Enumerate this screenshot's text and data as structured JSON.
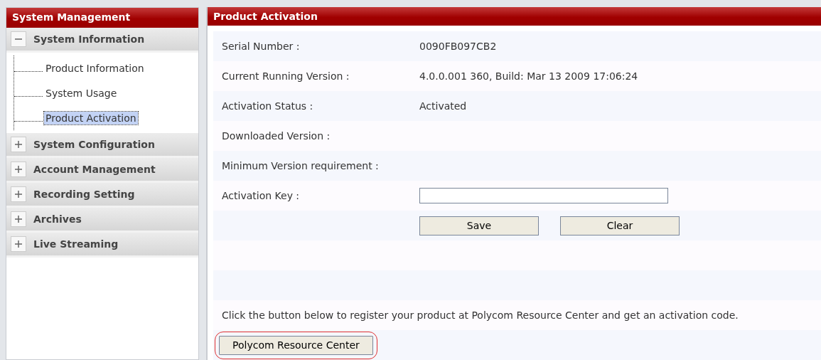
{
  "sidebar": {
    "title": "System Management",
    "groups": [
      {
        "label": "System Information",
        "expanded": true,
        "children": [
          {
            "label": "Product Information",
            "selected": false
          },
          {
            "label": "System Usage",
            "selected": false
          },
          {
            "label": "Product Activation",
            "selected": true
          }
        ]
      },
      {
        "label": "System Configuration",
        "expanded": false
      },
      {
        "label": "Account Management",
        "expanded": false
      },
      {
        "label": "Recording Setting",
        "expanded": false
      },
      {
        "label": "Archives",
        "expanded": false
      },
      {
        "label": "Live Streaming",
        "expanded": false
      }
    ]
  },
  "panel": {
    "title": "Product Activation",
    "rows": [
      {
        "kind": "info",
        "label": "Serial Number :",
        "value": "0090FB097CB2"
      },
      {
        "kind": "info",
        "label": "Current Running Version :",
        "value": "4.0.0.001 360, Build: Mar 13 2009 17:06:24"
      },
      {
        "kind": "info",
        "label": "Activation Status :",
        "value": "Activated"
      },
      {
        "kind": "info",
        "label": "Downloaded Version :"
      },
      {
        "kind": "info",
        "label": "Minimum Version requirement :"
      },
      {
        "kind": "input",
        "label": "Activation Key :"
      },
      {
        "kind": "buttons",
        "buttons": [
          "Save",
          "Clear"
        ]
      },
      {
        "kind": "blank"
      },
      {
        "kind": "blank"
      },
      {
        "kind": "note",
        "text": "Click the button below to register your product at Polycom Resource Center and get an activation code."
      },
      {
        "kind": "link_button",
        "label": "Polycom Resource Center",
        "highlighted": true
      }
    ]
  }
}
